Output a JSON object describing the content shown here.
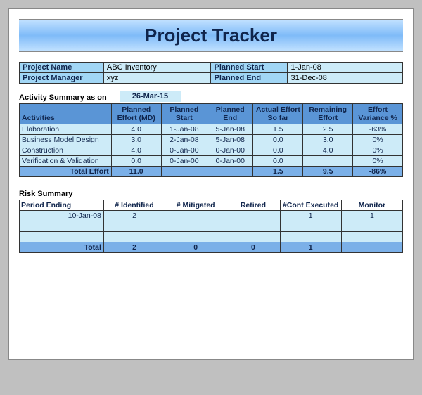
{
  "title": "Project Tracker",
  "info": {
    "project_name_label": "Project Name",
    "project_name": "ABC Inventory",
    "planned_start_label": "Planned Start",
    "planned_start": "1-Jan-08",
    "project_manager_label": "Project Manager",
    "project_manager": "xyz",
    "planned_end_label": "Planned End",
    "planned_end": "31-Dec-08"
  },
  "activity_summary_label": "Activity Summary as on",
  "activity_summary_date": "26-Mar-15",
  "activity_headers": {
    "activities": "Activities",
    "planned_effort": "Planned Effort (MD)",
    "planned_start": "Planned Start",
    "planned_end": "Planned End",
    "actual_effort": "Actual Effort So far",
    "remaining_effort": "Remaining Effort",
    "variance": "Effort Variance %"
  },
  "activities": [
    {
      "name": "Elaboration",
      "pe": "4.0",
      "ps": "1-Jan-08",
      "pend": "5-Jan-08",
      "ae": "1.5",
      "re": "2.5",
      "var": "-63%"
    },
    {
      "name": "Business Model Design",
      "pe": "3.0",
      "ps": "2-Jan-08",
      "pend": "5-Jan-08",
      "ae": "0.0",
      "re": "3.0",
      "var": "0%"
    },
    {
      "name": "Construction",
      "pe": "4.0",
      "ps": "0-Jan-00",
      "pend": "0-Jan-00",
      "ae": "0.0",
      "re": "4.0",
      "var": "0%"
    },
    {
      "name": "Verification & Validation",
      "pe": "0.0",
      "ps": "0-Jan-00",
      "pend": "0-Jan-00",
      "ae": "0.0",
      "re": "",
      "var": "0%"
    }
  ],
  "activity_total": {
    "label": "Total Effort",
    "pe": "11.0",
    "ps": "",
    "pend": "",
    "ae": "1.5",
    "re": "9.5",
    "var": "-86%"
  },
  "risk_title": "Risk Summary",
  "risk_headers": {
    "period": "Period Ending",
    "identified": "# Identified",
    "mitigated": "# Mitigated",
    "retired": "Retired",
    "cont_executed": "#Cont Executed",
    "monitor": "Monitor"
  },
  "risks": [
    {
      "period": "10-Jan-08",
      "id": "2",
      "mit": "",
      "ret": "",
      "cont": "1",
      "mon": "1"
    },
    {
      "period": "",
      "id": "",
      "mit": "",
      "ret": "",
      "cont": "",
      "mon": ""
    },
    {
      "period": "",
      "id": "",
      "mit": "",
      "ret": "",
      "cont": "",
      "mon": ""
    }
  ],
  "risk_total": {
    "label": "Total",
    "id": "2",
    "mit": "0",
    "ret": "0",
    "cont": "1",
    "mon": ""
  },
  "chart_data": [
    {
      "type": "table",
      "title": "Activity Summary",
      "columns": [
        "Activities",
        "Planned Effort (MD)",
        "Planned Start",
        "Planned End",
        "Actual Effort So far",
        "Remaining Effort",
        "Effort Variance %"
      ],
      "rows": [
        [
          "Elaboration",
          4.0,
          "1-Jan-08",
          "5-Jan-08",
          1.5,
          2.5,
          "-63%"
        ],
        [
          "Business Model Design",
          3.0,
          "2-Jan-08",
          "5-Jan-08",
          0.0,
          3.0,
          "0%"
        ],
        [
          "Construction",
          4.0,
          "0-Jan-00",
          "0-Jan-00",
          0.0,
          4.0,
          "0%"
        ],
        [
          "Verification & Validation",
          0.0,
          "0-Jan-00",
          "0-Jan-00",
          0.0,
          null,
          "0%"
        ],
        [
          "Total Effort",
          11.0,
          null,
          null,
          1.5,
          9.5,
          "-86%"
        ]
      ]
    },
    {
      "type": "table",
      "title": "Risk Summary",
      "columns": [
        "Period Ending",
        "# Identified",
        "# Mitigated",
        "Retired",
        "#Cont Executed",
        "Monitor"
      ],
      "rows": [
        [
          "10-Jan-08",
          2,
          null,
          null,
          1,
          1
        ],
        [
          "Total",
          2,
          0,
          0,
          1,
          null
        ]
      ]
    }
  ]
}
